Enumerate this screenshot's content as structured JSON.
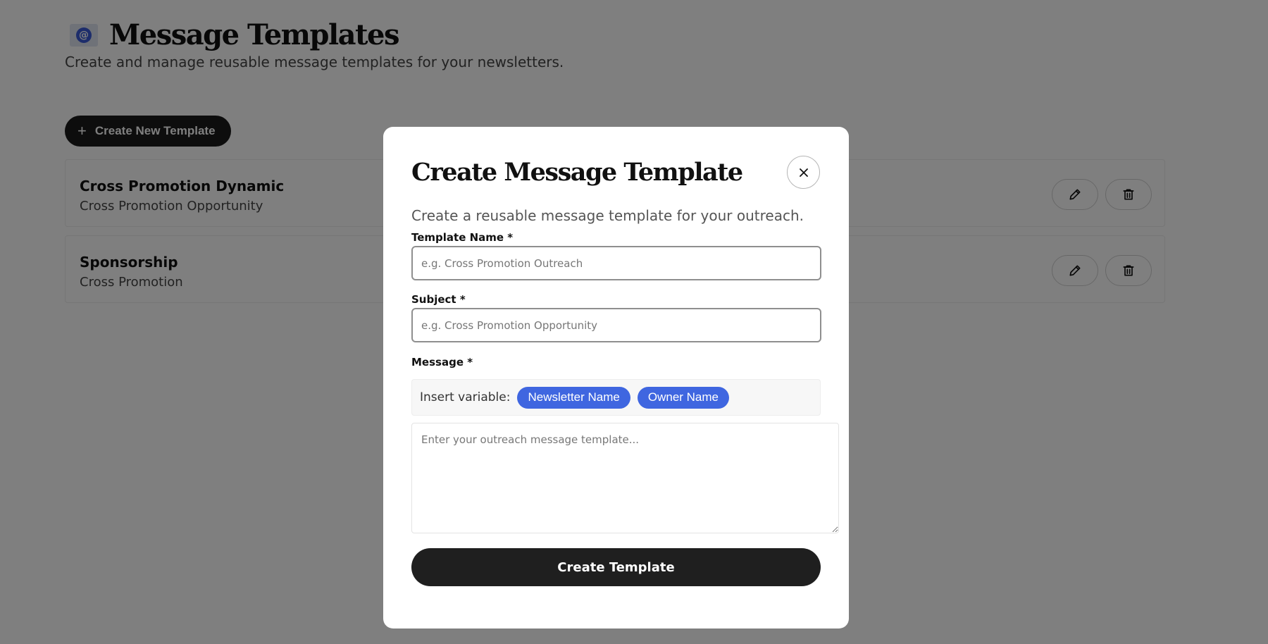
{
  "page": {
    "title": "Message Templates",
    "subtitle": "Create and manage reusable message templates for your newsletters.",
    "logo_icon": "at-sign-icon",
    "create_button_label": "Create New Template"
  },
  "templates": [
    {
      "name": "Cross Promotion Dynamic",
      "subject": "Cross Promotion Opportunity"
    },
    {
      "name": "Sponsorship",
      "subject": "Cross Promotion"
    }
  ],
  "modal": {
    "title": "Create Message Template",
    "description": "Create a reusable message template for your outreach.",
    "template_name": {
      "label": "Template Name *",
      "value": "",
      "placeholder": "e.g. Cross Promotion Outreach"
    },
    "subject": {
      "label": "Subject *",
      "value": "",
      "placeholder": "e.g. Cross Promotion Opportunity"
    },
    "message": {
      "label": "Message *",
      "insert_variable_label": "Insert variable:",
      "variables": [
        "Newsletter Name",
        "Owner Name"
      ],
      "value": "",
      "placeholder": "Enter your outreach message template..."
    },
    "submit_label": "Create Template"
  },
  "colors": {
    "overlay": "rgba(0,0,0,0.5)",
    "primary_dark": "#1f1f1f",
    "variable_chip": "#3f66e0"
  }
}
